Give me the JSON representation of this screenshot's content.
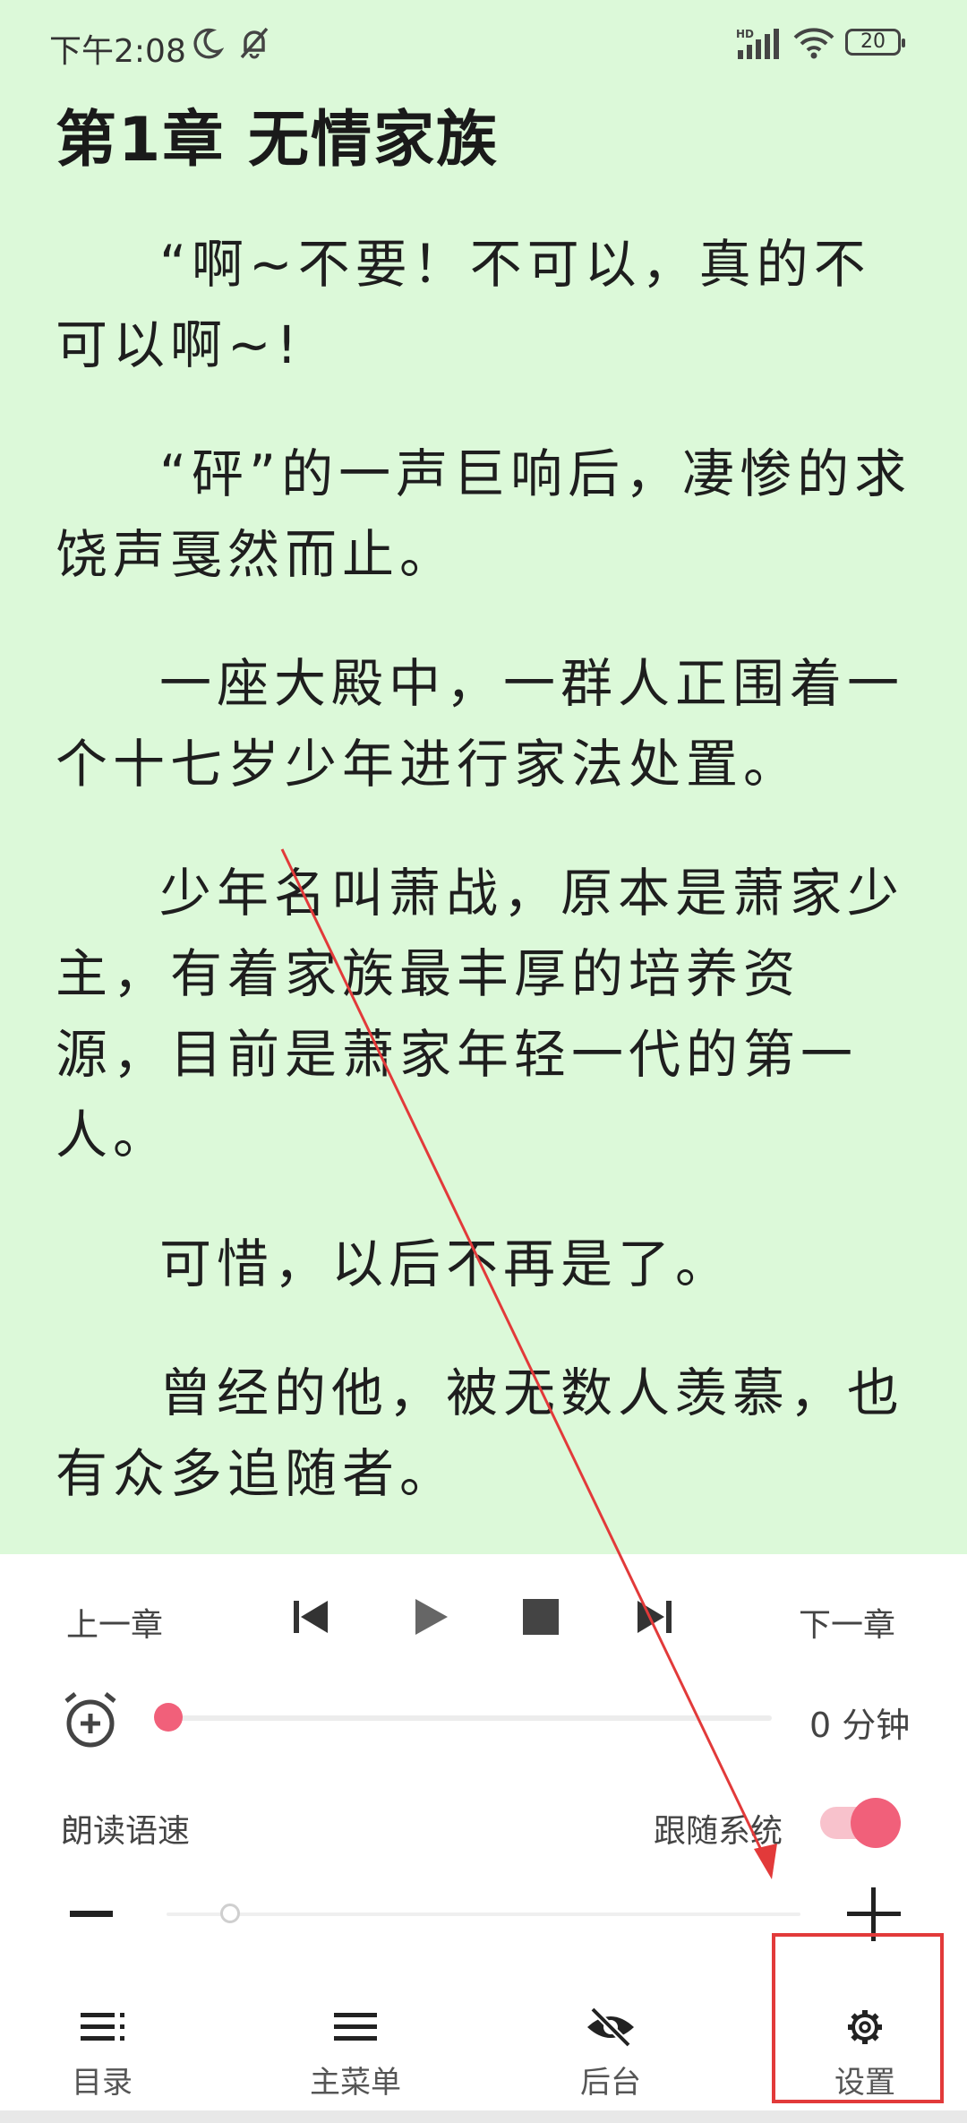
{
  "status_bar": {
    "time": "下午2:08",
    "battery": "20",
    "icons": [
      "moon-icon",
      "bell-off-icon",
      "hd-signal-icon",
      "wifi-icon",
      "battery-icon"
    ]
  },
  "reader": {
    "chapter_title": "第1章 无情家族",
    "paragraphs": [
      "“啊~不要！不可以，真的不可以啊~!",
      "“砰”的一声巨响后，凄惨的求饶声戛然而止。",
      "一座大殿中，一群人正围着一个十七岁少年进行家法处置。",
      "少年名叫萧战，原本是萧家少主，有着家族最丰厚的培养资源，目前是萧家年轻一代的第一人。",
      "可惜，以后不再是了。",
      "曾经的他，被无数人羡慕，也有众多追随者。"
    ],
    "background_color": "#dcf9d9"
  },
  "playback": {
    "prev_chapter": "上一章",
    "next_chapter": "下一章",
    "controls": [
      "skip-first-icon",
      "play-icon",
      "stop-icon",
      "skip-last-icon"
    ]
  },
  "timer": {
    "value": "0 分钟",
    "level": 0
  },
  "speed": {
    "label": "朗读语速",
    "follow_system_label": "跟随系统",
    "follow_system_on": true,
    "level": 0.1
  },
  "bottom_nav": {
    "toc": "目录",
    "main_menu": "主菜单",
    "background": "后台",
    "settings": "设置"
  },
  "colors": {
    "accent": "#f1607a",
    "annotation": "#e23a3a"
  }
}
